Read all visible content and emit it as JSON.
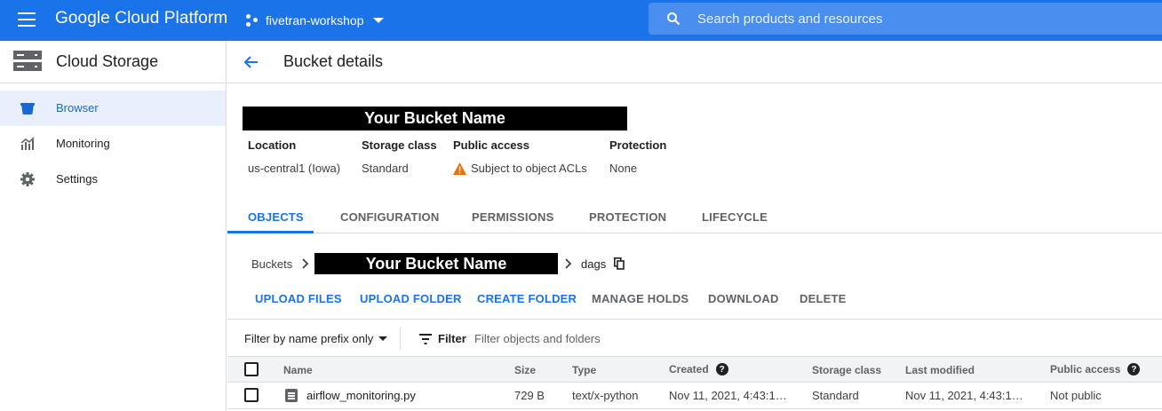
{
  "header": {
    "brand": "Google Cloud Platform",
    "project": "fivetran-workshop",
    "search_placeholder": "Search products and resources"
  },
  "sidebar": {
    "title": "Cloud Storage",
    "items": [
      {
        "label": "Browser",
        "icon": "bucket-icon",
        "active": true
      },
      {
        "label": "Monitoring",
        "icon": "monitoring-icon"
      },
      {
        "label": "Settings",
        "icon": "gear-icon"
      }
    ]
  },
  "page": {
    "title": "Bucket details",
    "bucket_name": "Your Bucket Name"
  },
  "properties": [
    {
      "label": "Location",
      "value": "us-central1 (Iowa)"
    },
    {
      "label": "Storage class",
      "value": "Standard"
    },
    {
      "label": "Public access",
      "value": "Subject to object ACLs",
      "icon": "warning-icon"
    },
    {
      "label": "Protection",
      "value": "None"
    }
  ],
  "tabs": [
    "OBJECTS",
    "CONFIGURATION",
    "PERMISSIONS",
    "PROTECTION",
    "LIFECYCLE"
  ],
  "breadcrumb": {
    "root": "Buckets",
    "bucket": "Your Bucket Name",
    "folder": "dags"
  },
  "actions": [
    "UPLOAD FILES",
    "UPLOAD FOLDER",
    "CREATE FOLDER",
    "MANAGE HOLDS",
    "DOWNLOAD",
    "DELETE"
  ],
  "filter": {
    "mode": "Filter by name prefix only",
    "label": "Filter",
    "placeholder": "Filter objects and folders"
  },
  "table": {
    "columns": [
      "Name",
      "Size",
      "Type",
      "Created",
      "Storage class",
      "Last modified",
      "Public access"
    ],
    "rows": [
      {
        "name": "airflow_monitoring.py",
        "size": "729 B",
        "type": "text/x-python",
        "created": "Nov 11, 2021, 4:43:1…",
        "storage_class": "Standard",
        "last_modified": "Nov 11, 2021, 4:43:1…",
        "public_access": "Not public"
      }
    ]
  },
  "colors": {
    "accent": "#1a73e8",
    "warning": "#e8710a"
  }
}
